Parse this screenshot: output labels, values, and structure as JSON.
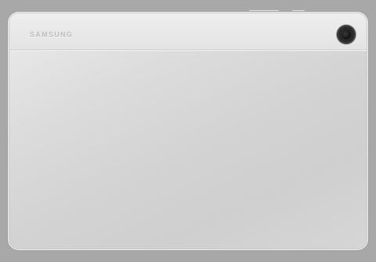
{
  "device": {
    "brand_logo": "SAMSUNG",
    "finish_color": "#d6d6d6",
    "background_color": "#a8a8a8"
  },
  "icons": {
    "camera": "camera-lens",
    "volume": "side-button",
    "power": "side-button"
  }
}
